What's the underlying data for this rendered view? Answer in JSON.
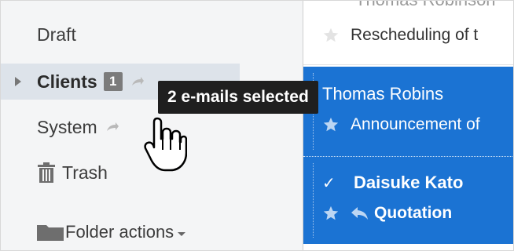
{
  "sidebar": {
    "folders": [
      {
        "label": "Draft"
      },
      {
        "label": "Clients",
        "count": "1"
      },
      {
        "label": "System"
      },
      {
        "label": "Trash"
      }
    ],
    "folder_actions_label": "Folder actions"
  },
  "messages": [
    {
      "sender": "Thomas Robinson",
      "subject": "Rescheduling of t",
      "selected": false
    },
    {
      "sender": "Thomas Robins",
      "subject": "Announcement of",
      "selected": true
    },
    {
      "sender": "Daisuke Kato",
      "subject": "Quotation",
      "selected": true,
      "checked": true
    }
  ],
  "drag_tooltip": "2 e-mails selected",
  "colors": {
    "selection": "#1b73d3",
    "sidebar_bg": "#f4f5f6",
    "hover_bg": "#dde3ea",
    "tooltip_bg": "#1f1f1f"
  },
  "icons": [
    "share-icon",
    "trash-icon",
    "folder-icon",
    "star-icon",
    "reply-icon",
    "check-icon",
    "hand-cursor-icon"
  ]
}
